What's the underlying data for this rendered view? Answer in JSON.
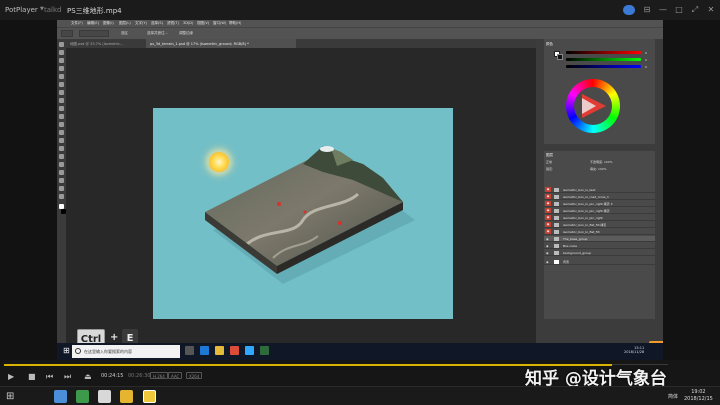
{
  "player": {
    "app_name": "PotPlayer",
    "mode": "talkd",
    "filename": "PS三维地形.mp4",
    "current_time": "00:24:15",
    "total_time": "00:26:30",
    "tags": [
      "H.264",
      "AAC",
      "X264"
    ],
    "progress_fraction": 0.915
  },
  "photoshop": {
    "menu": [
      "文件(F)",
      "编辑(E)",
      "图像(I)",
      "图层(L)",
      "文字(Y)",
      "选择(S)",
      "滤镜(T)",
      "3D(D)",
      "视图(V)",
      "窗口(W)",
      "帮助(H)"
    ],
    "options": {
      "mode_label": "选区",
      "select_subject": "选择并遮住...",
      "align_label": "调整边缘"
    },
    "tabs": [
      {
        "label": "地图.psd @ 33.7% (Isometric...",
        "active": false
      },
      {
        "label": "ps_3d_terrain_1.psd @ 17% (Isometric_ground, RGB/8) *",
        "active": true
      }
    ],
    "color_panel": {
      "tab": "颜色",
      "values": [
        "0",
        "0",
        "0"
      ]
    },
    "layers_panel": {
      "tab": "图层",
      "mode": "正常",
      "opacity_label": "不透明度: 100%",
      "lock_label": "锁定:",
      "fill_label": "填充: 100%",
      "layers": [
        {
          "name": "isometric_box_lo_text",
          "red": true,
          "selected": false
        },
        {
          "name": "isometric_box_lo_road_cross_1",
          "red": true,
          "selected": false
        },
        {
          "name": "isometric_box_lo_pin_right 拷贝 3",
          "red": true,
          "selected": false
        },
        {
          "name": "isometric_box_lo_pin_right 拷贝",
          "red": true,
          "selected": false
        },
        {
          "name": "isometric_box_lo_pin_right",
          "red": true,
          "selected": false
        },
        {
          "name": "isometric_box_lo_flat_fill 拷贝",
          "red": true,
          "selected": false
        },
        {
          "name": "isometric_box_lo_flat_fill",
          "red": true,
          "selected": false
        },
        {
          "name": "The_base_group",
          "red": false,
          "selected": true
        },
        {
          "name": "Box-cube",
          "red": false,
          "selected": false
        },
        {
          "name": "background_group",
          "red": false,
          "selected": false
        },
        {
          "name": "背景",
          "red": false,
          "selected": false
        }
      ]
    }
  },
  "shortcut_overlay": {
    "key1": "Ctrl",
    "plus": "+",
    "key2": "E"
  },
  "windows_taskbar": {
    "search_placeholder": "在这里输入你要搜索的内容",
    "clock_time": "15:11",
    "clock_date": "2018/11/28"
  },
  "watermark": "知乎 @设计气象台",
  "host_taskbar": {
    "ime": "简体",
    "time": "19:02",
    "date": "2018/12/15"
  },
  "colors": {
    "canvas_bg": "#73bfc8",
    "progress_fill": "#d8b400",
    "layer_red": "#c14033"
  }
}
